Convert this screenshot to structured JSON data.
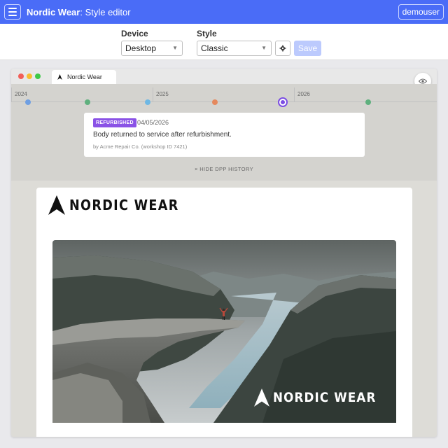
{
  "app": {
    "brand": "Nordic Wear",
    "page": ": Style editor",
    "user": "demouser"
  },
  "controls": {
    "device_label": "Device",
    "device_value": "Desktop",
    "style_label": "Style",
    "style_value": "Classic",
    "save_label": "Save"
  },
  "browser": {
    "tab_title": "Nordic Wear"
  },
  "timeline": {
    "years": [
      "2024",
      "2025",
      "2026"
    ],
    "events": [
      {
        "color": "#6f9fe2"
      },
      {
        "color": "#5fb07e"
      },
      {
        "color": "#6fb8e4"
      },
      {
        "color": "#e5895e"
      },
      {
        "color": "#7b4de3",
        "active": true
      },
      {
        "color": "#5fb07e"
      }
    ],
    "card": {
      "badge": "REFURBISHED",
      "date": "04/05/2026",
      "text": "Body returned to service after refurbishment.",
      "by": "by Acme Repair Co. (workshop ID 7421)"
    },
    "hide_label": "× HIDE DPP HISTORY"
  },
  "preview": {
    "logo_text": "NORDIC WEAR",
    "hero_logo_text": "NORDIC WEAR"
  },
  "colors": {
    "accent": "#4a6cf7",
    "badge": "#8a52e6"
  }
}
